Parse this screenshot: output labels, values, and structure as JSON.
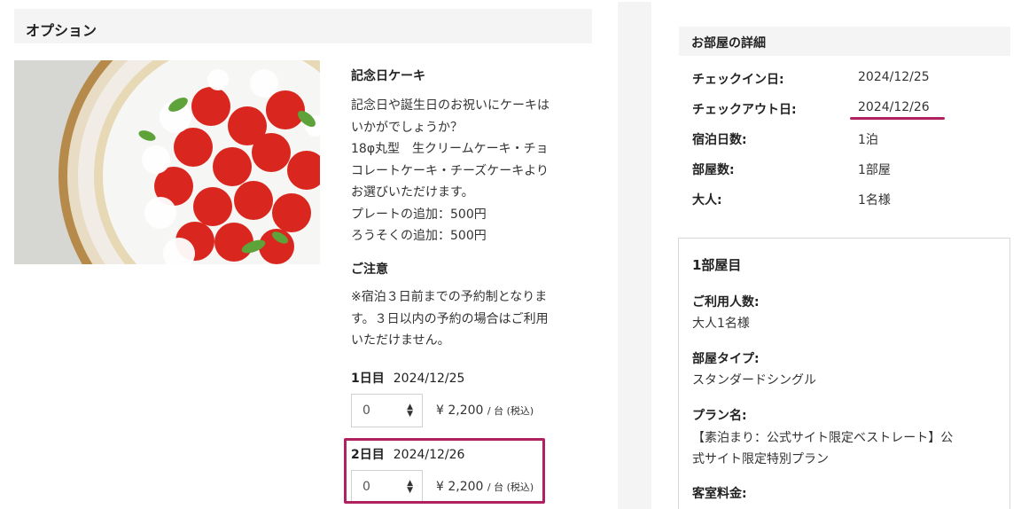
{
  "options": {
    "header": "オプション",
    "item_title": "記念日ケーキ",
    "item_description": "記念日や誕生日のお祝いにケーキはいかがでしょうか？\n18φ丸型　生クリームケーキ・チョコレートケーキ・チーズケーキよりお選びいただけます。\nプレートの追加：500円\nろうそくの追加：500円",
    "notice_title": "ご注意",
    "notice_body": "※宿泊３日前までの予約制となります。３日以内の予約の場合はご利用いただけません。",
    "days": [
      {
        "label": "1日目",
        "date": "2024/12/25",
        "quantity": "0",
        "price": "¥ 2,200",
        "unit": "/ 台 (税込)"
      },
      {
        "label": "2日目",
        "date": "2024/12/26",
        "quantity": "0",
        "price": "¥ 2,200",
        "unit": "/ 台 (税込)"
      }
    ]
  },
  "room_details": {
    "header": "お部屋の詳細",
    "rows": [
      {
        "label": "チェックイン日:",
        "value": "2024/12/25"
      },
      {
        "label": "チェックアウト日:",
        "value": "2024/12/26"
      },
      {
        "label": "宿泊日数:",
        "value": "1泊"
      },
      {
        "label": "部屋数:",
        "value": "1部屋"
      },
      {
        "label": "大人:",
        "value": "1名様"
      }
    ]
  },
  "room1": {
    "title": "1部屋目",
    "guests_label": "ご利用人数:",
    "guests_value": "大人1名様",
    "type_label": "部屋タイプ:",
    "type_value": "スタンダードシングル",
    "plan_label": "プラン名:",
    "plan_value": "【素泊まり：公式サイト限定ベストレート】公式サイト限定特別プラン",
    "fee_label": "客室料金:"
  },
  "colors": {
    "highlight": "#b0215f",
    "panel": "#f4f4f4"
  },
  "icons": {
    "select_arrow": "updown-chevron-icon"
  }
}
